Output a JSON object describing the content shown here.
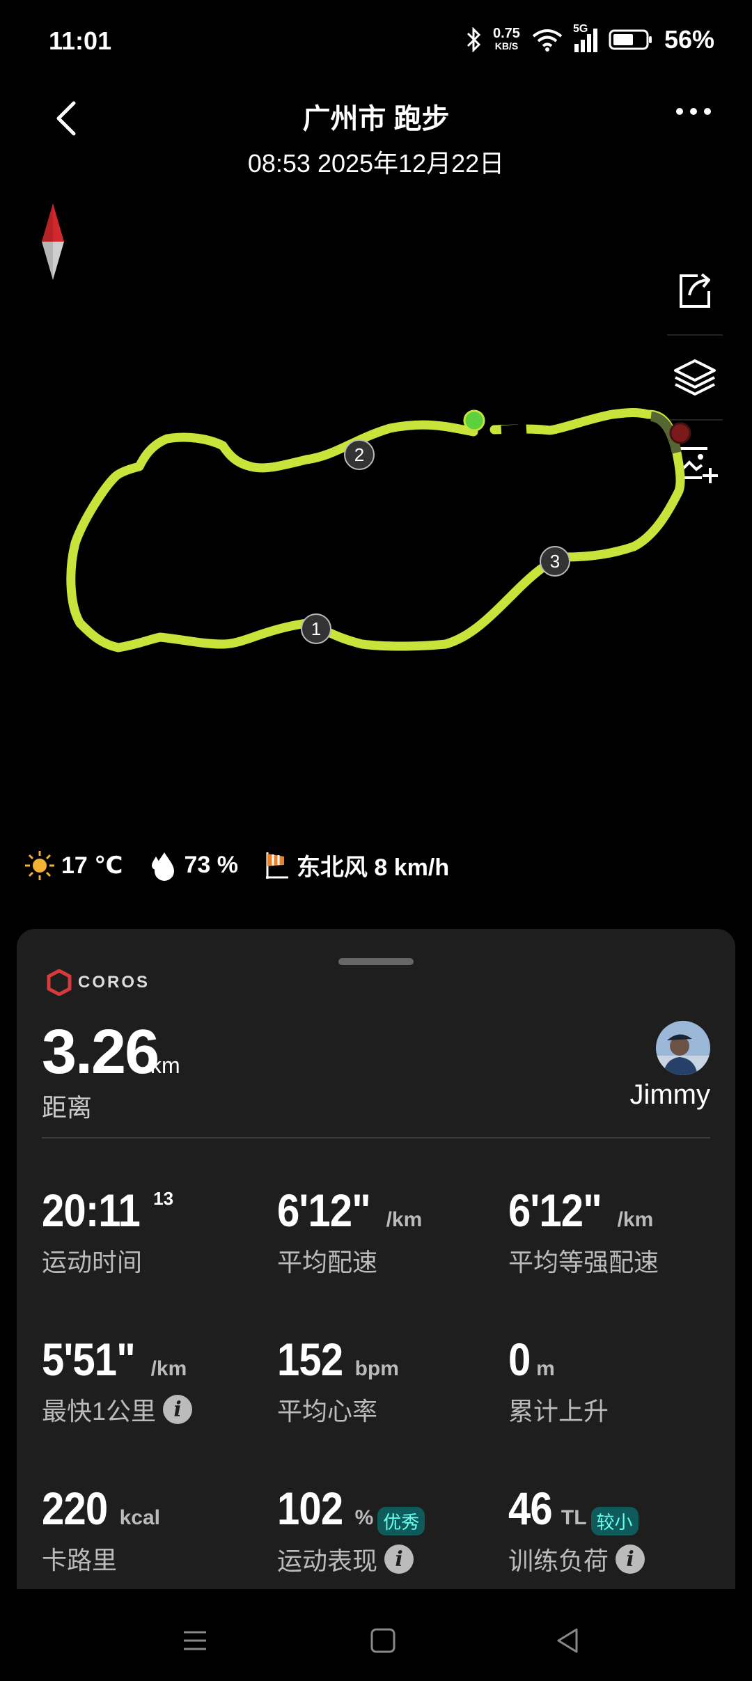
{
  "status_bar": {
    "time": "11:01",
    "net_speed_value": "0.75",
    "net_speed_unit": "KB/S",
    "network": "5G",
    "battery": "56%"
  },
  "header": {
    "title": "广州市 跑步",
    "subtitle": "08:53 2025年12月22日"
  },
  "map": {
    "route_color": "#c8e33a",
    "markers": [
      "1",
      "2",
      "3"
    ]
  },
  "weather": {
    "temperature": "17 ℃",
    "humidity": "73 %",
    "wind": "东北风 8 km/h"
  },
  "card": {
    "brand": "COROS",
    "distance_value": "3.26",
    "distance_unit": "km",
    "distance_label": "距离",
    "user_name": "Jimmy",
    "stats": [
      {
        "value": "20:11",
        "sup": "13",
        "unit": "",
        "label": "运动时间"
      },
      {
        "value": "6'12\"",
        "unit": "/km",
        "label": "平均配速"
      },
      {
        "value": "6'12\"",
        "unit": "/km",
        "label": "平均等强配速"
      },
      {
        "value": "5'51\"",
        "unit": "/km",
        "label": "最快1公里"
      },
      {
        "value": "152",
        "unit": "bpm",
        "label": "平均心率"
      },
      {
        "value": "0",
        "unit": "m",
        "label": "累计上升"
      },
      {
        "value": "220",
        "unit": "kcal",
        "label": "卡路里"
      },
      {
        "value": "102",
        "unit": "%",
        "badge": "优秀",
        "label": "运动表现"
      },
      {
        "value": "46",
        "unit": "TL",
        "badge": "较小",
        "label": "训练负荷"
      }
    ]
  }
}
